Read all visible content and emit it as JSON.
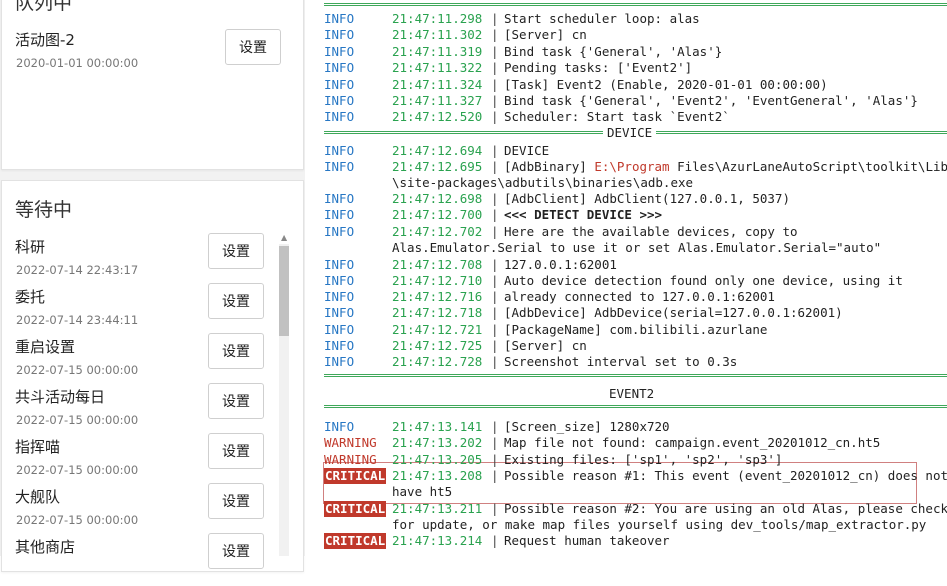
{
  "left": {
    "running_title": "队列中",
    "running_task": {
      "name": "活动图-2",
      "time": "2020-01-01 00:00:00",
      "button": "设置"
    },
    "pending_title": "等待中",
    "pending_tasks": [
      {
        "name": "科研",
        "time": "2022-07-14 22:43:17",
        "button": "设置"
      },
      {
        "name": "委托",
        "time": "2022-07-14 23:44:11",
        "button": "设置"
      },
      {
        "name": "重启设置",
        "time": "2022-07-15 00:00:00",
        "button": "设置"
      },
      {
        "name": "共斗活动每日",
        "time": "2022-07-15 00:00:00",
        "button": "设置"
      },
      {
        "name": "指挥喵",
        "time": "2022-07-15 00:00:00",
        "button": "设置"
      },
      {
        "name": "大舰队",
        "time": "2022-07-15 00:00:00",
        "button": "设置"
      },
      {
        "name": "其他商店",
        "time": "",
        "button": "设置"
      }
    ]
  },
  "log": {
    "lines": [
      {
        "level": "INFO",
        "time": "21:47:11.298",
        "msg": "Start scheduler loop: alas"
      },
      {
        "level": "INFO",
        "time": "21:47:11.302",
        "msg": "[Server] cn"
      },
      {
        "level": "INFO",
        "time": "21:47:11.319",
        "msg": "Bind task {'General', 'Alas'}"
      },
      {
        "level": "INFO",
        "time": "21:47:11.322",
        "msg": "Pending tasks: ['Event2']"
      },
      {
        "level": "INFO",
        "time": "21:47:11.324",
        "msg": "[Task] Event2 (Enable, 2020-01-01 00:00:00)"
      },
      {
        "level": "INFO",
        "time": "21:47:11.327",
        "msg": "Bind task {'General', 'Event2', 'EventGeneral', 'Alas'}"
      },
      {
        "level": "INFO",
        "time": "21:47:12.520",
        "msg": "Scheduler: Start task `Event2`"
      },
      {
        "level": "INFO",
        "time": "21:47:12.694",
        "msg": "DEVICE"
      },
      {
        "level": "INFO",
        "time": "21:47:12.695",
        "msg_prefix": "[AdbBinary] ",
        "msg_path": "E:\\Program",
        "msg_suffix": " Files\\AzurLaneAutoScript\\toolkit\\Lib"
      },
      {
        "level": "",
        "time": "",
        "msg": "\\site-packages\\adbutils\\binaries\\adb.exe",
        "cont": true
      },
      {
        "level": "INFO",
        "time": "21:47:12.698",
        "msg": "[AdbClient] AdbClient(127.0.0.1, 5037)"
      },
      {
        "level": "INFO",
        "time": "21:47:12.700",
        "msg": "<<< DETECT DEVICE >>>",
        "bold": true
      },
      {
        "level": "INFO",
        "time": "21:47:12.702",
        "msg": "Here are the available devices, copy to"
      },
      {
        "level": "",
        "time": "",
        "msg": "Alas.Emulator.Serial to use it or set Alas.Emulator.Serial=\"auto\"",
        "cont": true
      },
      {
        "level": "INFO",
        "time": "21:47:12.708",
        "msg": "127.0.0.1:62001"
      },
      {
        "level": "INFO",
        "time": "21:47:12.710",
        "msg": "Auto device detection found only one device, using it"
      },
      {
        "level": "INFO",
        "time": "21:47:12.716",
        "msg": "already connected to 127.0.0.1:62001"
      },
      {
        "level": "INFO",
        "time": "21:47:12.718",
        "msg": "[AdbDevice] AdbDevice(serial=127.0.0.1:62001)"
      },
      {
        "level": "INFO",
        "time": "21:47:12.721",
        "msg": "[PackageName] com.bilibili.azurlane"
      },
      {
        "level": "INFO",
        "time": "21:47:12.725",
        "msg": "[Server] cn"
      },
      {
        "level": "INFO",
        "time": "21:47:12.728",
        "msg": "Screenshot interval set to 0.3s"
      },
      {
        "level": "INFO",
        "time": "21:47:13.141",
        "msg": "[Screen_size] 1280x720"
      },
      {
        "level": "WARNING",
        "time": "21:47:13.202",
        "msg": "Map file not found: campaign.event_20201012_cn.ht5"
      },
      {
        "level": "WARNING",
        "time": "21:47:13.205",
        "msg": "Existing files: ['sp1', 'sp2', 'sp3']"
      },
      {
        "level": "CRITICAL",
        "time": "21:47:13.208",
        "msg": "Possible reason #1: This event (event_20201012_cn) does not"
      },
      {
        "level": "",
        "time": "",
        "msg": "have ht5",
        "cont": true
      },
      {
        "level": "CRITICAL",
        "time": "21:47:13.211",
        "msg": "Possible reason #2: You are using an old Alas, please check"
      },
      {
        "level": "",
        "time": "",
        "msg": "for update, or make map files yourself using dev_tools/map_extractor.py",
        "cont": true
      },
      {
        "level": "CRITICAL",
        "time": "21:47:13.214",
        "msg": "Request human takeover"
      }
    ],
    "sections": {
      "device": "DEVICE",
      "event2": "EVENT2"
    }
  }
}
